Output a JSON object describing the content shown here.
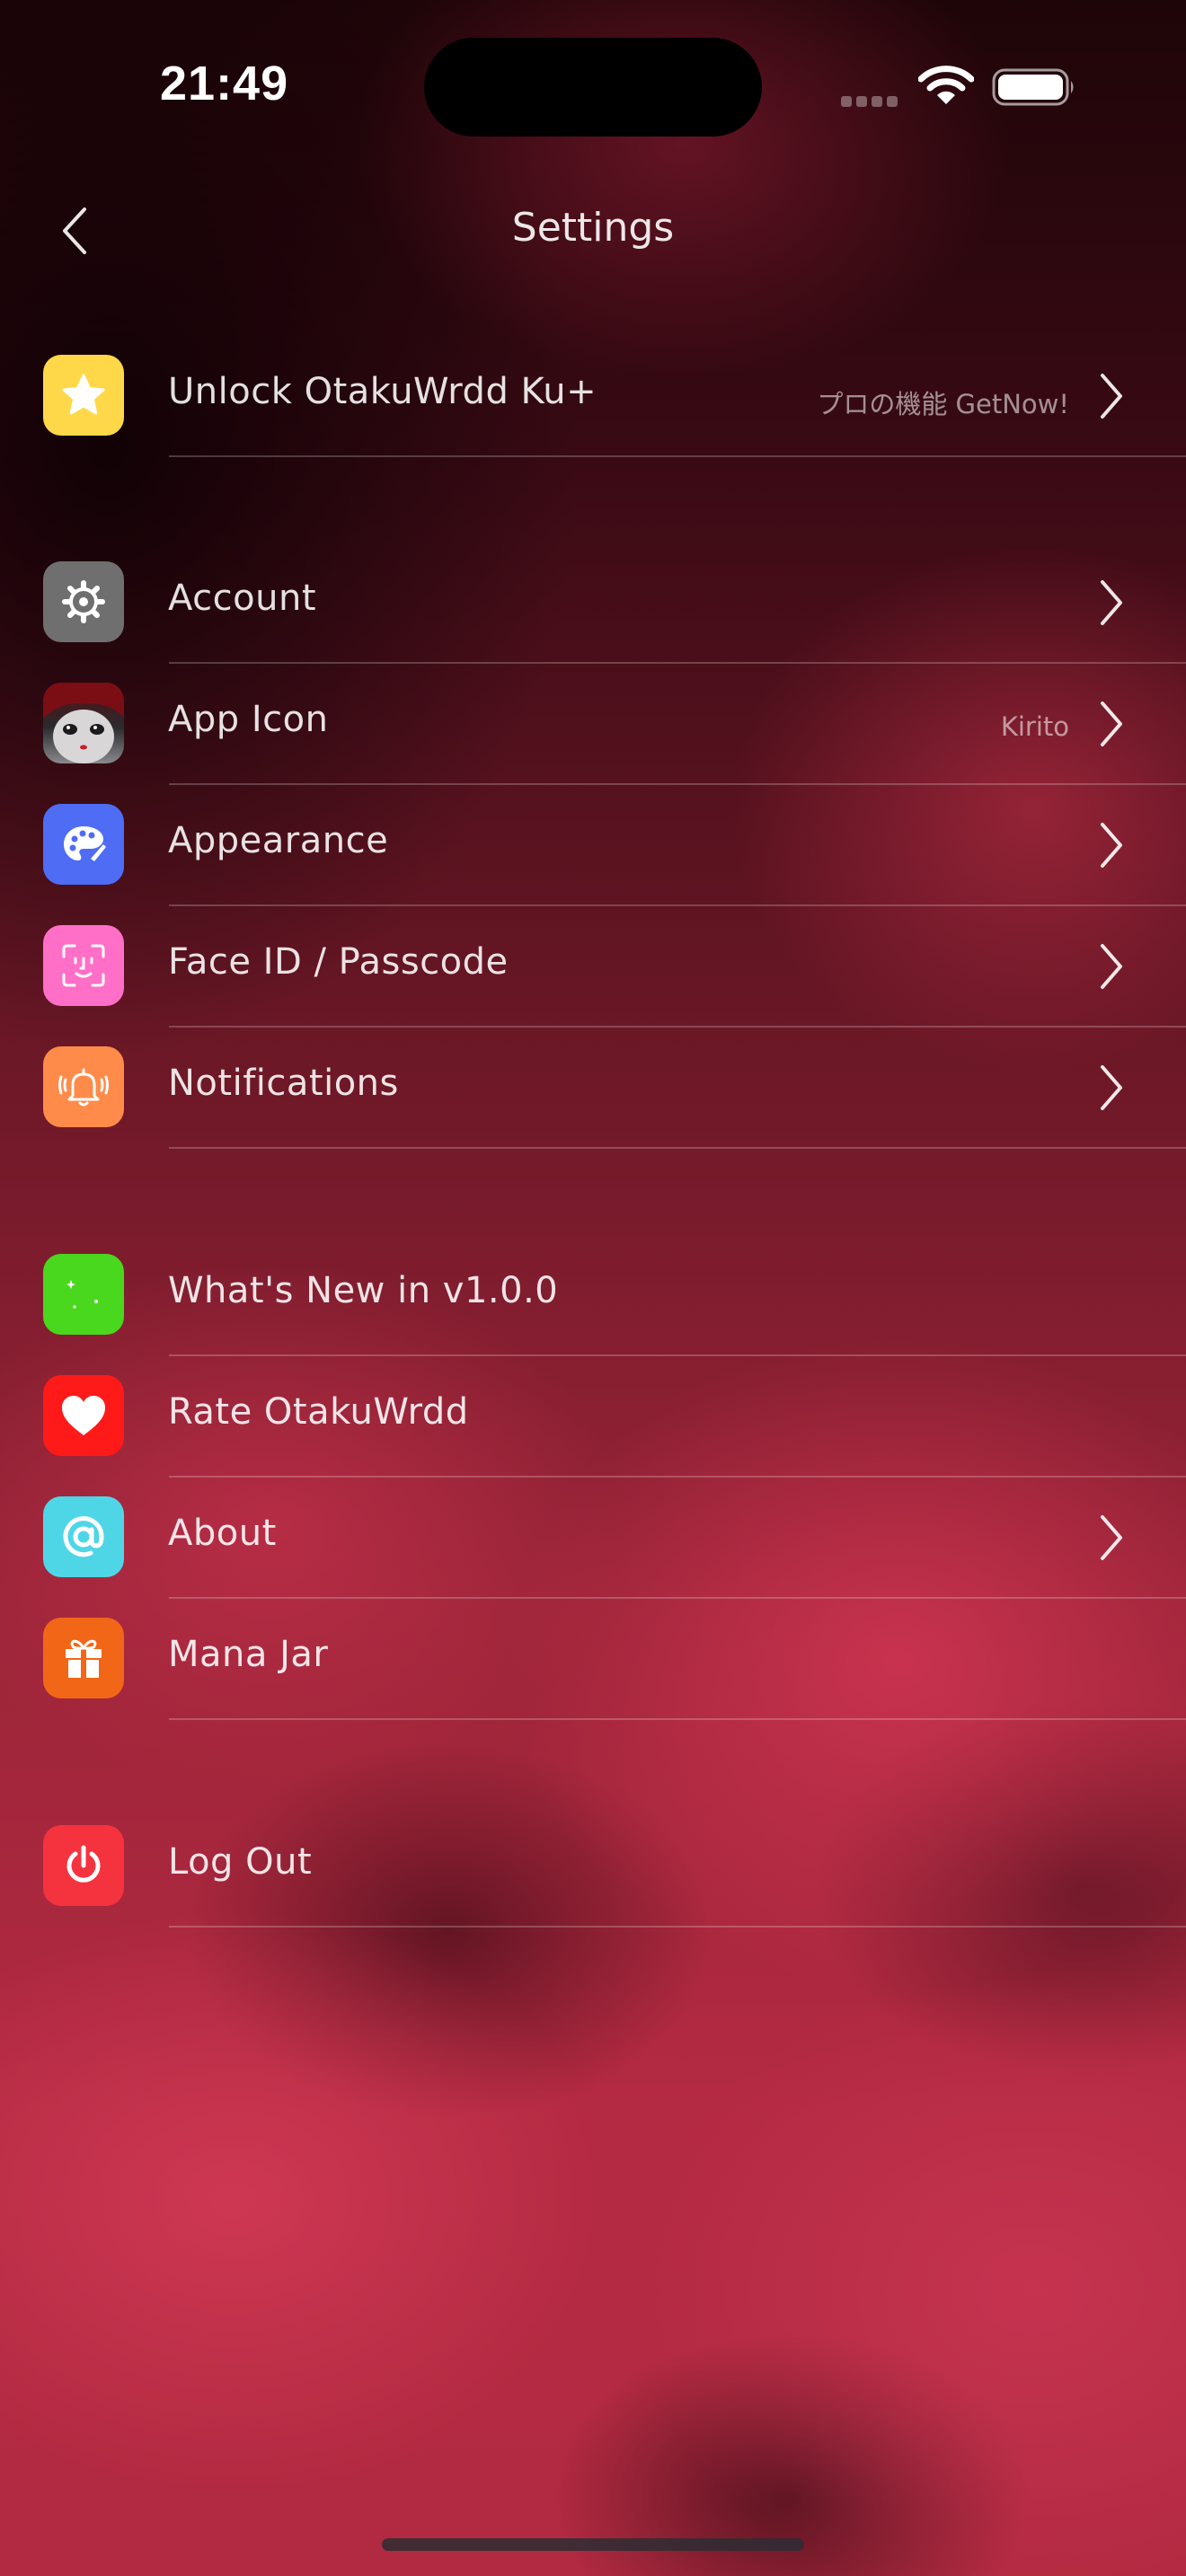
{
  "status_bar": {
    "time": "21:49"
  },
  "nav": {
    "title": "Settings"
  },
  "rows": {
    "unlock": {
      "label": "Unlock OtakuWrdd Ku+",
      "detail": "プロの機能 GetNow!"
    },
    "account": {
      "label": "Account"
    },
    "app_icon": {
      "label": "App Icon",
      "detail": "Kirito"
    },
    "appearance": {
      "label": "Appearance"
    },
    "face_id": {
      "label": "Face ID / Passcode"
    },
    "notifications": {
      "label": "Notifications"
    },
    "whats_new": {
      "label": "What's New in v1.0.0"
    },
    "rate": {
      "label": "Rate OtakuWrdd"
    },
    "about": {
      "label": "About"
    },
    "mana_jar": {
      "label": "Mana Jar"
    },
    "log_out": {
      "label": "Log Out"
    }
  },
  "icon_colors": {
    "unlock": "#FFD84A",
    "account": "#6F6F6F",
    "appearance": "#4F6CF5",
    "face_id": "#FF6FC8",
    "notifications": "#FF8B4A",
    "whats_new": "#49D81E",
    "rate": "#FF1A1A",
    "about": "#4FD6E6",
    "mana_jar": "#F26618",
    "log_out": "#F5333F"
  },
  "icons": {
    "unlock": "star-icon",
    "account": "gear-icon",
    "app_icon": "anime-character-icon",
    "appearance": "palette-icon",
    "face_id": "face-id-icon",
    "notifications": "bell-icon",
    "whats_new": "sparkle-icon",
    "rate": "heart-icon",
    "about": "at-sign-icon",
    "mana_jar": "gift-icon",
    "log_out": "power-icon"
  }
}
